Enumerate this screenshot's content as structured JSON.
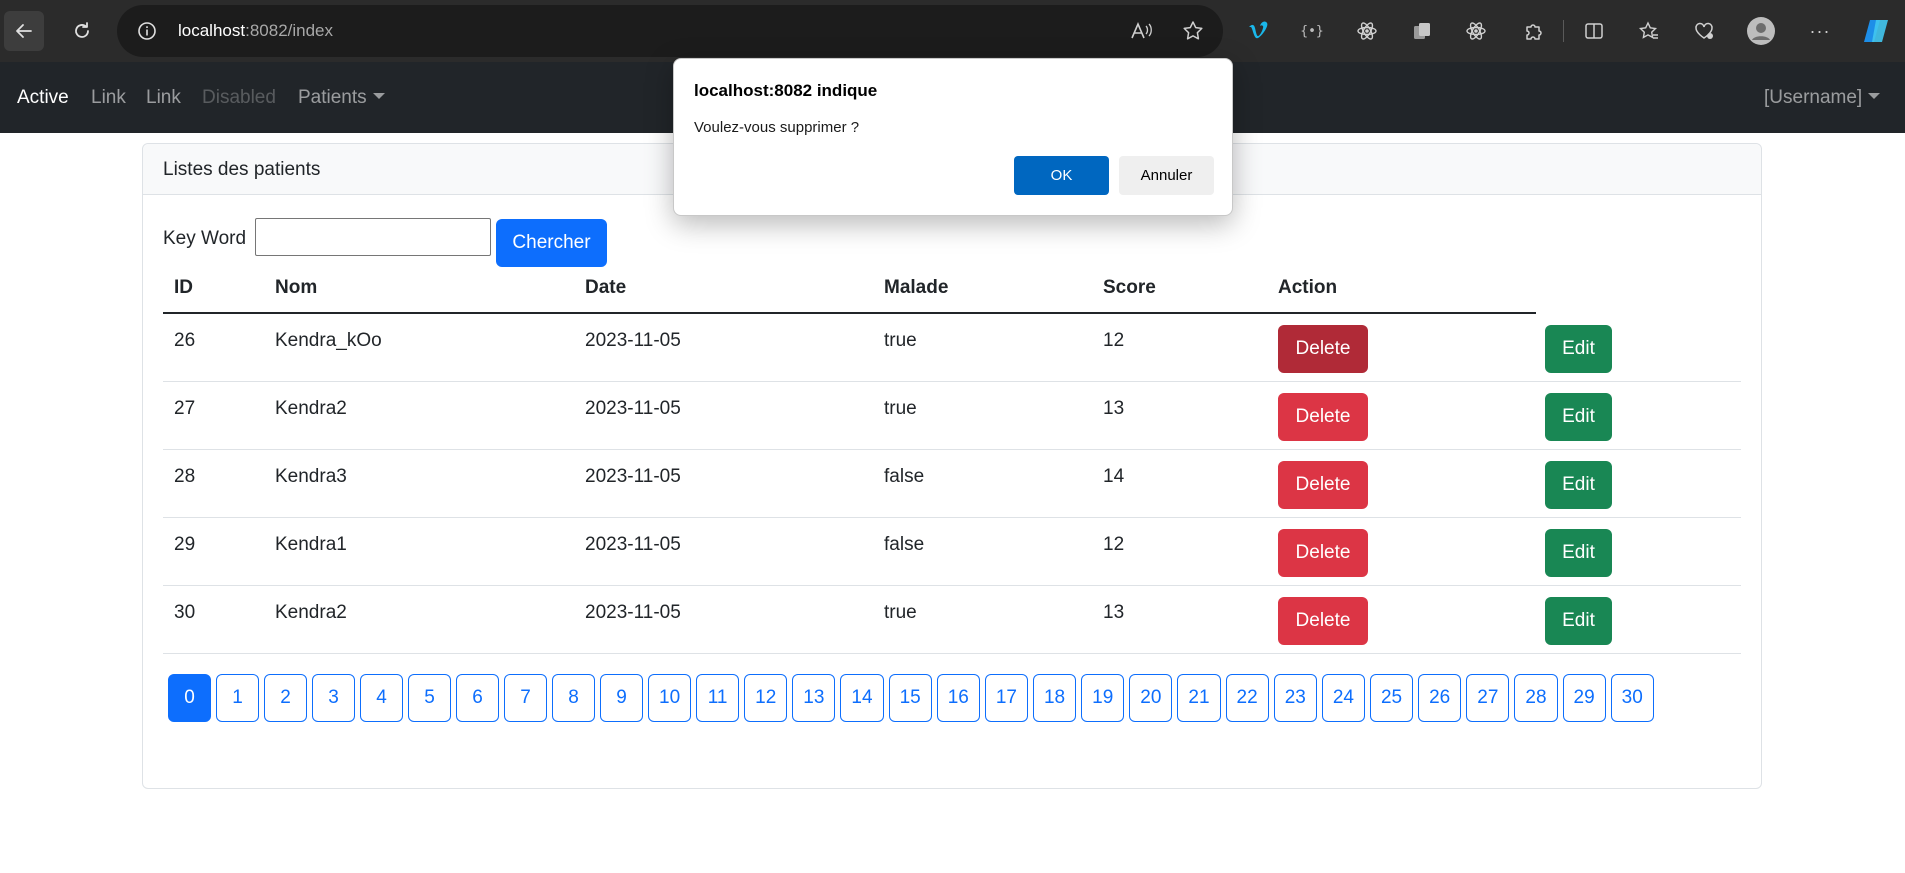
{
  "browser": {
    "url_host": "localhost",
    "url_rest": ":8082/index"
  },
  "navbar": {
    "active": "Active",
    "link1": "Link",
    "link2": "Link",
    "disabled": "Disabled",
    "patients": "Patients",
    "username": "[Username]"
  },
  "card": {
    "title": "Listes des patients",
    "keyword_label": "Key Word",
    "keyword_value": "",
    "search_button": "Chercher"
  },
  "table": {
    "headers": [
      "ID",
      "Nom",
      "Date",
      "Malade",
      "Score",
      "Action"
    ],
    "rows": [
      {
        "id": "26",
        "nom": "Kendra_kOo",
        "date": "2023-11-05",
        "malade": "true",
        "score": "12"
      },
      {
        "id": "27",
        "nom": "Kendra2",
        "date": "2023-11-05",
        "malade": "true",
        "score": "13"
      },
      {
        "id": "28",
        "nom": "Kendra3",
        "date": "2023-11-05",
        "malade": "false",
        "score": "14"
      },
      {
        "id": "29",
        "nom": "Kendra1",
        "date": "2023-11-05",
        "malade": "false",
        "score": "12"
      },
      {
        "id": "30",
        "nom": "Kendra2",
        "date": "2023-11-05",
        "malade": "true",
        "score": "13"
      }
    ],
    "delete_label": "Delete",
    "edit_label": "Edit"
  },
  "pagination": {
    "current": "0",
    "pages": [
      "0",
      "1",
      "2",
      "3",
      "4",
      "5",
      "6",
      "7",
      "8",
      "9",
      "10",
      "11",
      "12",
      "13",
      "14",
      "15",
      "16",
      "17",
      "18",
      "19",
      "20",
      "21",
      "22",
      "23",
      "24",
      "25",
      "26",
      "27",
      "28",
      "29",
      "30"
    ]
  },
  "dialog": {
    "title": "localhost:8082 indique",
    "message": "Voulez-vous supprimer ?",
    "ok": "OK",
    "cancel": "Annuler"
  },
  "colors": {
    "primary": "#0d6efd",
    "danger": "#dc3545",
    "success": "#198754",
    "navbar": "#212529",
    "dialog_ok": "#0067c0"
  }
}
